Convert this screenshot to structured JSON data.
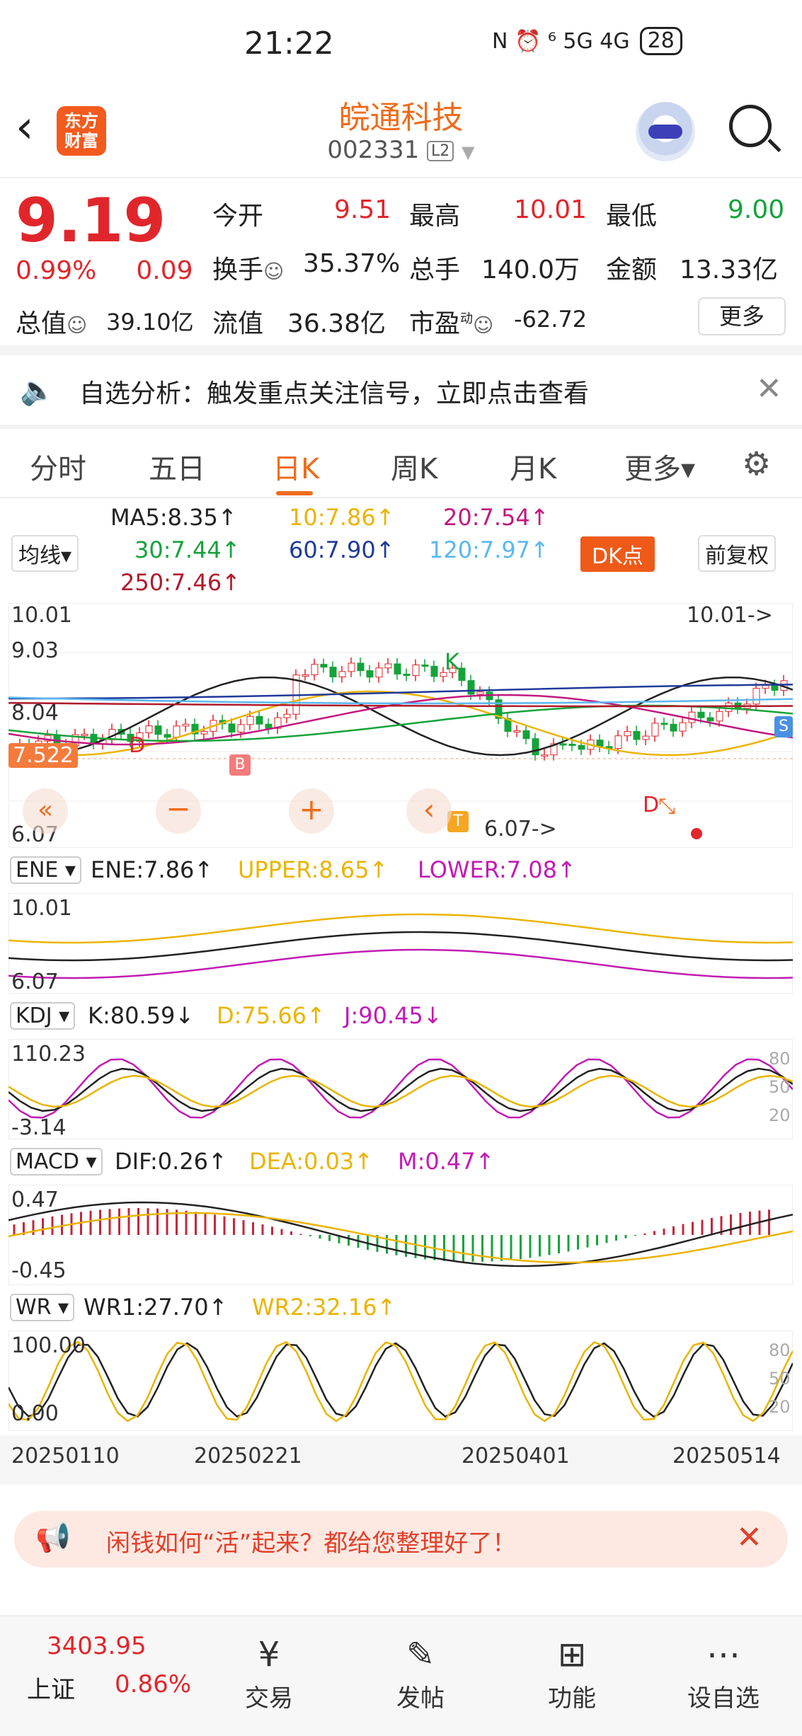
{
  "status_bar": {
    "time": "21:22",
    "signal": "N ⏰ ⁶ 5G 4G",
    "battery": "28"
  },
  "header": {
    "logo": "东方\n财富",
    "title": "皖通科技",
    "code": "002331",
    "level": "L2"
  },
  "quote": {
    "price": "9.19",
    "change_pct": "0.99%",
    "change": "0.09",
    "open_label": "今开",
    "open": "9.51",
    "high_label": "最高",
    "high": "10.01",
    "low_label": "最低",
    "low": "9.00",
    "turnover_label": "换手",
    "turnover": "35.37%",
    "volume_label": "总手",
    "volume": "140.0万",
    "amount_label": "金额",
    "amount": "13.33亿",
    "mktcap_label": "总值",
    "mktcap": "39.10亿",
    "float_label": "流值",
    "float": "36.38亿",
    "pe_label": "市盈",
    "pe_sup": "动",
    "pe": "-62.72",
    "more": "更多"
  },
  "alert": {
    "text": "自选分析：触发重点关注信号，立即点击查看"
  },
  "tabs": [
    "分时",
    "五日",
    "日K",
    "周K",
    "月K",
    "更多▾"
  ],
  "active_tab": "日K",
  "ma": {
    "selector": "均线▾",
    "ma5": "MA5:8.35↑",
    "ma10": "10:7.86↑",
    "ma20": "20:7.54↑",
    "ma30": "30:7.44↑",
    "ma60": "60:7.90↑",
    "ma120": "120:7.97↑",
    "ma250": "250:7.46↑",
    "dk": "DK点",
    "adjust": "前复权"
  },
  "kline": {
    "y_top": "10.01",
    "y2": "9.03",
    "y3": "8.04",
    "y_bottom": "6.07",
    "current": "7.522",
    "max_tag": "10.01->",
    "min_tag": "6.07->",
    "mark_b": "B",
    "mark_s": "S",
    "mark_t": "T",
    "mark_k": "K",
    "mark_d": "D"
  },
  "ene": {
    "sel": "ENE ▾",
    "ene": "ENE:7.86↑",
    "upper": "UPPER:8.65↑",
    "lower": "LOWER:7.08↑",
    "top": "10.01",
    "bottom": "6.07"
  },
  "kdj": {
    "sel": "KDJ ▾",
    "k": "K:80.59↓",
    "d": "D:75.66↑",
    "j": "J:90.45↓",
    "top": "110.23",
    "bottom": "-3.14",
    "r80": "80",
    "r50": "50",
    "r20": "20"
  },
  "macd": {
    "sel": "MACD ▾",
    "dif": "DIF:0.26↑",
    "dea": "DEA:0.03↑",
    "m": "M:0.47↑",
    "top": "0.47",
    "bottom": "-0.45"
  },
  "wr": {
    "sel": "WR ▾",
    "wr1": "WR1:27.70↑",
    "wr2": "WR2:32.16↑",
    "top": "100.00",
    "bottom": "0.00",
    "r80": "80",
    "r50": "50",
    "r20": "20"
  },
  "dates": [
    "20250110",
    "20250221",
    "20250401",
    "20250514"
  ],
  "promo": {
    "text": "闲钱如何“活”起来？都给您整理好了！"
  },
  "bottom": {
    "index_value": "3403.95",
    "index_name": "上证",
    "index_pct": "0.86%",
    "items": [
      "交易",
      "发帖",
      "功能",
      "设自选"
    ]
  },
  "colors": {
    "accent": "#ef6c1b",
    "up": "#e0262b",
    "down": "#14a33a"
  }
}
